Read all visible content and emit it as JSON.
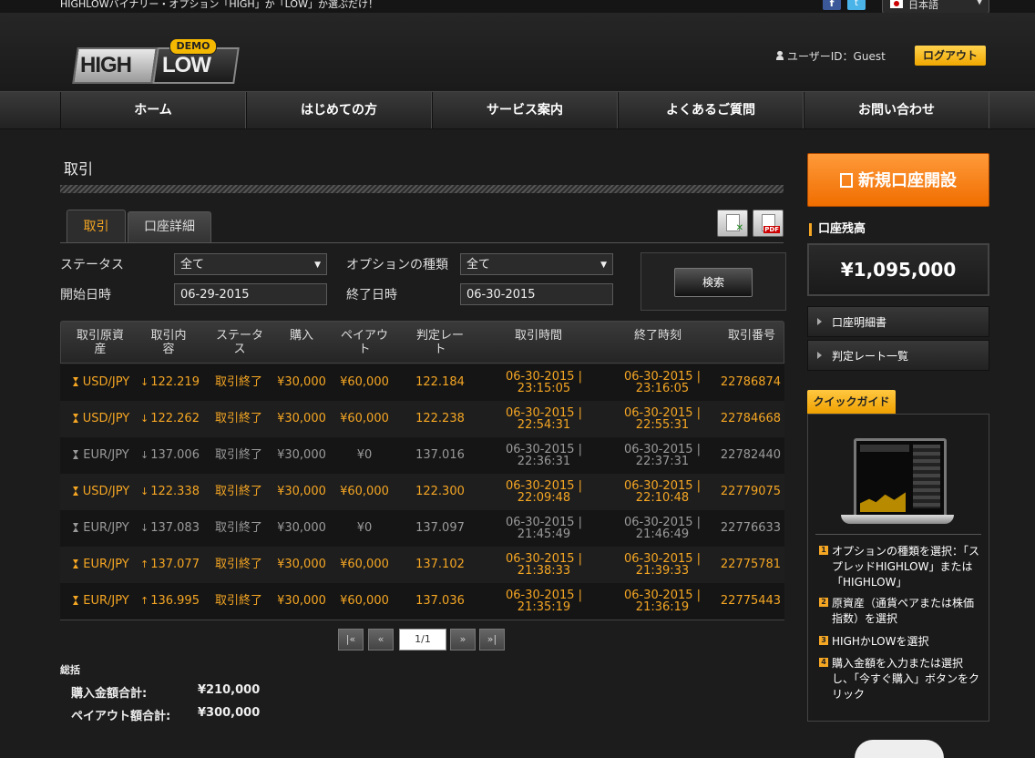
{
  "topbar": {
    "tagline": "HIGHLOWバイナリー・オプション「HIGH」か「LOW」か選ぶだけ！",
    "facebook_icon": "f",
    "twitter_icon": "t",
    "language": "日本語"
  },
  "header": {
    "logo": {
      "left": "HIGH",
      "right": "LOW",
      "badge": "DEMO"
    },
    "user": "ユーザーID：Guest",
    "logout": "ログアウト"
  },
  "nav": {
    "items": [
      "ホーム",
      "はじめての方",
      "サービス案内",
      "よくあるご質問",
      "お問い合わせ"
    ]
  },
  "page": {
    "title": "取引",
    "tabs": {
      "active": "取引",
      "other": "口座詳細"
    },
    "export_excel_icon": "excel-icon",
    "export_pdf_badge": "PDF"
  },
  "filters": {
    "status_label": "ステータス",
    "status_value": "全て",
    "option_type_label": "オプションの種類",
    "option_type_value": "全て",
    "start_label": "開始日時",
    "start_value": "06-29-2015",
    "end_label": "終了日時",
    "end_value": "06-30-2015",
    "search_button": "検索"
  },
  "table": {
    "headers": [
      [
        "取引原資",
        "産"
      ],
      [
        "取引内",
        "容"
      ],
      [
        "ステータ",
        "ス"
      ],
      [
        "購入",
        ""
      ],
      [
        "ペイアウ",
        "ト"
      ],
      [
        "判定レー",
        "ト"
      ],
      [
        "取引時間",
        ""
      ],
      [
        "終了時刻",
        ""
      ],
      [
        "取引番号",
        ""
      ]
    ],
    "rows": [
      {
        "asset": "USD/JPY",
        "dir": "↓",
        "rate": "122.219",
        "status": "取引終了",
        "buy": "¥30,000",
        "payout": "¥60,000",
        "judge": "122.184",
        "open1": "06-30-2015 |",
        "open2": "23:15:05",
        "close1": "06-30-2015 |",
        "close2": "23:16:05",
        "id": "22786874",
        "result": "win"
      },
      {
        "asset": "USD/JPY",
        "dir": "↓",
        "rate": "122.262",
        "status": "取引終了",
        "buy": "¥30,000",
        "payout": "¥60,000",
        "judge": "122.238",
        "open1": "06-30-2015 |",
        "open2": "22:54:31",
        "close1": "06-30-2015 |",
        "close2": "22:55:31",
        "id": "22784668",
        "result": "win"
      },
      {
        "asset": "EUR/JPY",
        "dir": "↓",
        "rate": "137.006",
        "status": "取引終了",
        "buy": "¥30,000",
        "payout": "¥0",
        "judge": "137.016",
        "open1": "06-30-2015 |",
        "open2": "22:36:31",
        "close1": "06-30-2015 |",
        "close2": "22:37:31",
        "id": "22782440",
        "result": "lose"
      },
      {
        "asset": "USD/JPY",
        "dir": "↓",
        "rate": "122.338",
        "status": "取引終了",
        "buy": "¥30,000",
        "payout": "¥60,000",
        "judge": "122.300",
        "open1": "06-30-2015 |",
        "open2": "22:09:48",
        "close1": "06-30-2015 |",
        "close2": "22:10:48",
        "id": "22779075",
        "result": "win"
      },
      {
        "asset": "EUR/JPY",
        "dir": "↓",
        "rate": "137.083",
        "status": "取引終了",
        "buy": "¥30,000",
        "payout": "¥0",
        "judge": "137.097",
        "open1": "06-30-2015 |",
        "open2": "21:45:49",
        "close1": "06-30-2015 |",
        "close2": "21:46:49",
        "id": "22776633",
        "result": "lose"
      },
      {
        "asset": "EUR/JPY",
        "dir": "↑",
        "rate": "137.077",
        "status": "取引終了",
        "buy": "¥30,000",
        "payout": "¥60,000",
        "judge": "137.102",
        "open1": "06-30-2015 |",
        "open2": "21:38:33",
        "close1": "06-30-2015 |",
        "close2": "21:39:33",
        "id": "22775781",
        "result": "win"
      },
      {
        "asset": "EUR/JPY",
        "dir": "↑",
        "rate": "136.995",
        "status": "取引終了",
        "buy": "¥30,000",
        "payout": "¥60,000",
        "judge": "137.036",
        "open1": "06-30-2015 |",
        "open2": "21:35:19",
        "close1": "06-30-2015 |",
        "close2": "21:36:19",
        "id": "22775443",
        "result": "win"
      }
    ]
  },
  "pager": {
    "first": "|«",
    "prev": "«",
    "page": "1/1",
    "next": "»",
    "last": "»|"
  },
  "summary": {
    "title": "総括",
    "buy_label": "購入金額合計:",
    "buy_value": "¥210,000",
    "payout_label": "ペイアウト額合計:",
    "payout_value": "¥300,000"
  },
  "sidebar": {
    "open_account": "新規口座開設",
    "balance_title": "口座残高",
    "balance": "¥1,095,000",
    "link1": "口座明細書",
    "link2": "判定レート一覧",
    "quickguide_tab": "クイックガイド",
    "steps": [
      {
        "num": "1",
        "text": "オプションの種類を選択：「スプレッドHIGHLOW」または「HIGHLOW」"
      },
      {
        "num": "2",
        "text": "原資産（通貨ペアまたは株価指数）を選択"
      },
      {
        "num": "3",
        "text": "HIGHかLOWを選択"
      },
      {
        "num": "4",
        "text": "購入金額を入力または選択し、「今すぐ購入」ボタンをクリック"
      }
    ]
  },
  "colors": {
    "accent": "#f5a623",
    "orange_button": "#f47a10",
    "background": "#1c1c1c",
    "loss_text": "#9a9a9a"
  }
}
